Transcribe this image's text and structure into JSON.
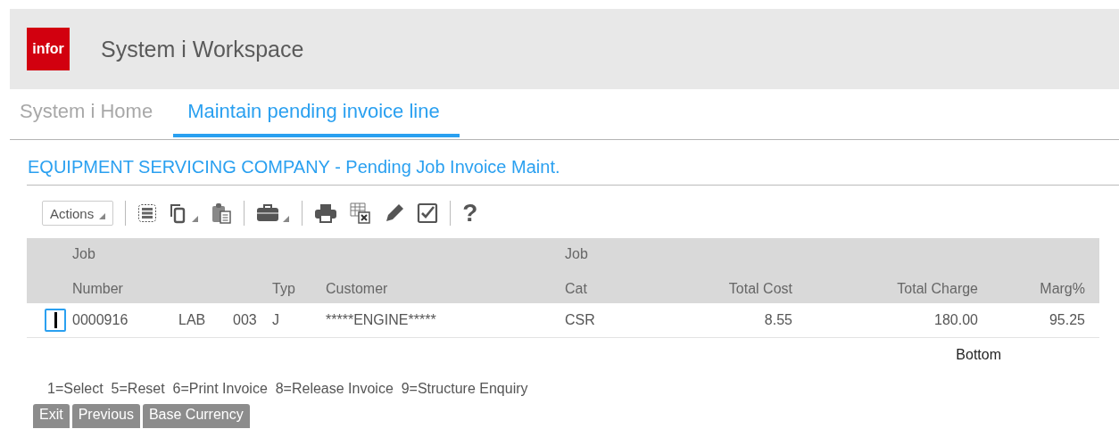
{
  "header": {
    "logo": "infor",
    "title": "System i Workspace"
  },
  "tabs": [
    {
      "label": "System i Home",
      "selected": false
    },
    {
      "label": "Maintain pending invoice line",
      "selected": true
    }
  ],
  "page_title": "EQUIPMENT SERVICING COMPANY - Pending Job Invoice Maint.",
  "toolbar": {
    "actions": "Actions",
    "help": "?"
  },
  "table": {
    "columns": [
      {
        "lines": [
          "Job",
          "Number"
        ],
        "kind": "text"
      },
      {
        "kind": "text"
      },
      {
        "kind": "text"
      },
      {
        "lines": [
          "Typ"
        ],
        "kind": "text"
      },
      {
        "lines": [
          "Customer"
        ],
        "kind": "text"
      },
      {
        "lines": [
          "Job",
          "Cat"
        ],
        "kind": "text"
      },
      {
        "lines": [
          "Total Cost"
        ],
        "kind": "amount"
      },
      {
        "lines": [
          "Total Charge"
        ],
        "kind": "amount"
      },
      {
        "lines": [
          "Marg%"
        ],
        "kind": "amount"
      }
    ],
    "rows": [
      {
        "focused": true,
        "cells": [
          "0000916",
          "LAB",
          "003",
          "J",
          "*****ENGINE*****",
          "CSR",
          "8.55",
          "180.00",
          "95.25"
        ]
      }
    ]
  },
  "position": "Bottom",
  "legend": "1=Select  5=Reset  6=Print Invoice  8=Release Invoice  9=Structure Enquiry",
  "buttons": [
    "Exit",
    "Previous",
    "Base Currency"
  ]
}
